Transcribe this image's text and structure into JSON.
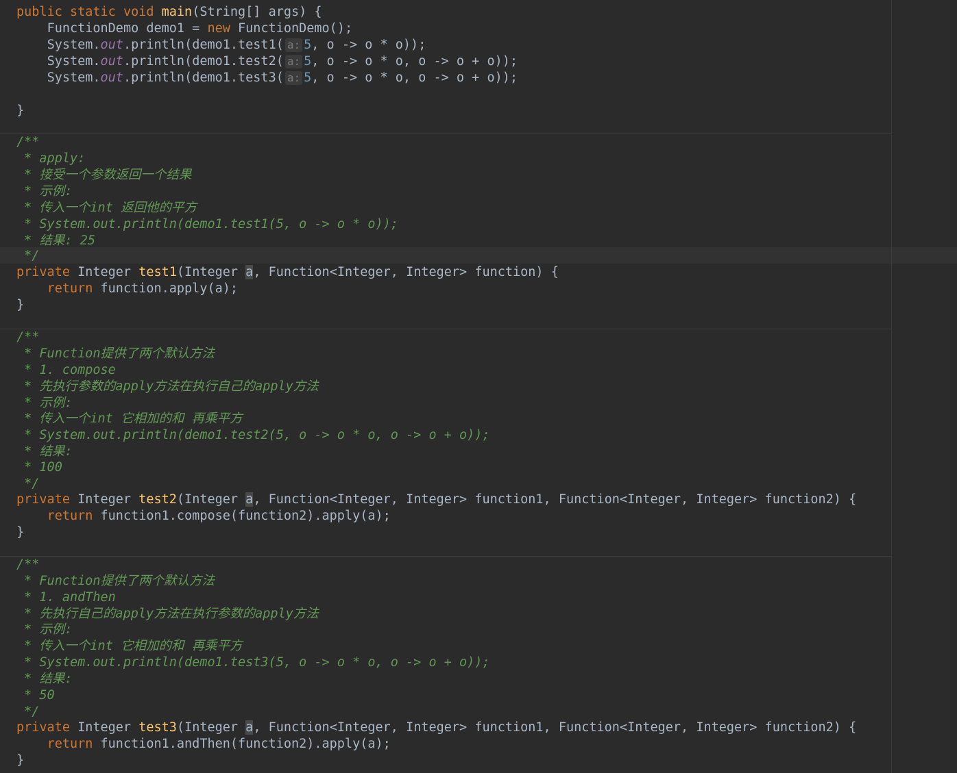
{
  "main": {
    "sig_public": "public",
    "sig_static": "static",
    "sig_void": "void",
    "sig_name": "main",
    "sig_params": "(String[] args) {",
    "decl_text": "FunctionDemo demo1 = ",
    "decl_new": "new",
    "decl_ctor": " FunctionDemo();",
    "calls": [
      {
        "prefix": "System.",
        "field": "out",
        "mid": ".println(demo1.test1(",
        "hint": "a:",
        "num": "5",
        "rest": ", o -> o * o));"
      },
      {
        "prefix": "System.",
        "field": "out",
        "mid": ".println(demo1.test2(",
        "hint": "a:",
        "num": "5",
        "rest": ", o -> o * o, o -> o + o));"
      },
      {
        "prefix": "System.",
        "field": "out",
        "mid": ".println(demo1.test3(",
        "hint": "a:",
        "num": "5",
        "rest": ", o -> o * o, o -> o + o));"
      }
    ],
    "close": "}"
  },
  "test1": {
    "doc": [
      "/**",
      " * apply:",
      " * 接受一个参数返回一个结果",
      " * 示例:",
      " * 传入一个int 返回他的平方",
      " * System.out.println(demo1.test1(5, o -> o * o));",
      " * 结果: 25",
      " */"
    ],
    "sig_private": "private",
    "sig_type": " Integer ",
    "sig_name": "test1",
    "sig_open": "(Integer ",
    "sig_param": "a",
    "sig_rest": ", Function<Integer, Integer> function) {",
    "body_return": "return",
    "body_rest": " function.apply(a);",
    "close": "}"
  },
  "test2": {
    "doc": [
      "/**",
      " * Function提供了两个默认方法",
      " * 1. compose",
      " * 先执行参数的apply方法在执行自己的apply方法",
      " * 示例:",
      " * 传入一个int 它相加的和 再乘平方",
      " * System.out.println(demo1.test2(5, o -> o * o, o -> o + o));",
      " * 结果:",
      " * 100",
      " */"
    ],
    "sig_private": "private",
    "sig_type": " Integer ",
    "sig_name": "test2",
    "sig_open": "(Integer ",
    "sig_param": "a",
    "sig_rest": ", Function<Integer, Integer> function1, Function<Integer, Integer> function2) {",
    "body_return": "return",
    "body_rest": " function1.compose(function2).apply(a);",
    "close": "}"
  },
  "test3": {
    "doc": [
      "/**",
      " * Function提供了两个默认方法",
      " * 1. andThen",
      " * 先执行自己的apply方法在执行参数的apply方法",
      " * 示例:",
      " * 传入一个int 它相加的和 再乘平方",
      " * System.out.println(demo1.test3(5, o -> o * o, o -> o + o));",
      " * 结果:",
      " * 50",
      " */"
    ],
    "sig_private": "private",
    "sig_type": " Integer ",
    "sig_name": "test3",
    "sig_open": "(Integer ",
    "sig_param": "a",
    "sig_rest": ", Function<Integer, Integer> function1, Function<Integer, Integer> function2) {",
    "body_return": "return",
    "body_rest": " function1.andThen(function2).apply(a);",
    "close": "}"
  },
  "colors": {
    "background": "#2b2b2b",
    "keyword": "#cc7832",
    "method_name": "#ffc66d",
    "doc_comment": "#629755",
    "number": "#6897bb",
    "static_field": "#9876aa",
    "text": "#a9b7c6"
  }
}
